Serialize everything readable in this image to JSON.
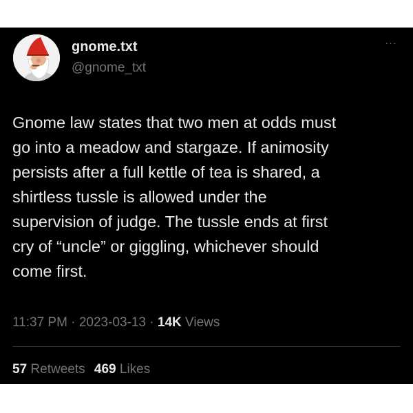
{
  "author": {
    "display_name": "gnome.txt",
    "handle": "@gnome_txt",
    "avatar_icon": "gnome-avatar-icon"
  },
  "more_label": "···",
  "tweet": {
    "text": "Gnome law states that two men at  odds must\ngo into a meadow and stargaze. If animosity\npersists after a full kettle of tea is shared, a\nshirtless tussle is allowed under the\nsupervision of judge. The tussle ends at first\ncry of “uncle” or giggling, whichever should\ncome first."
  },
  "meta": {
    "time": "11:37 PM",
    "separator": " · ",
    "date": "2023-03-13",
    "views_count": "14K",
    "views_label": " Views"
  },
  "stats": {
    "retweets_count": "57",
    "retweets_label": " Retweets",
    "likes_count": "469",
    "likes_label": " Likes"
  },
  "colors": {
    "background": "#000000",
    "text": "#e7e9ea",
    "muted": "#71767b",
    "divider": "#2f3336",
    "gnome_hat": "#d42a20"
  }
}
